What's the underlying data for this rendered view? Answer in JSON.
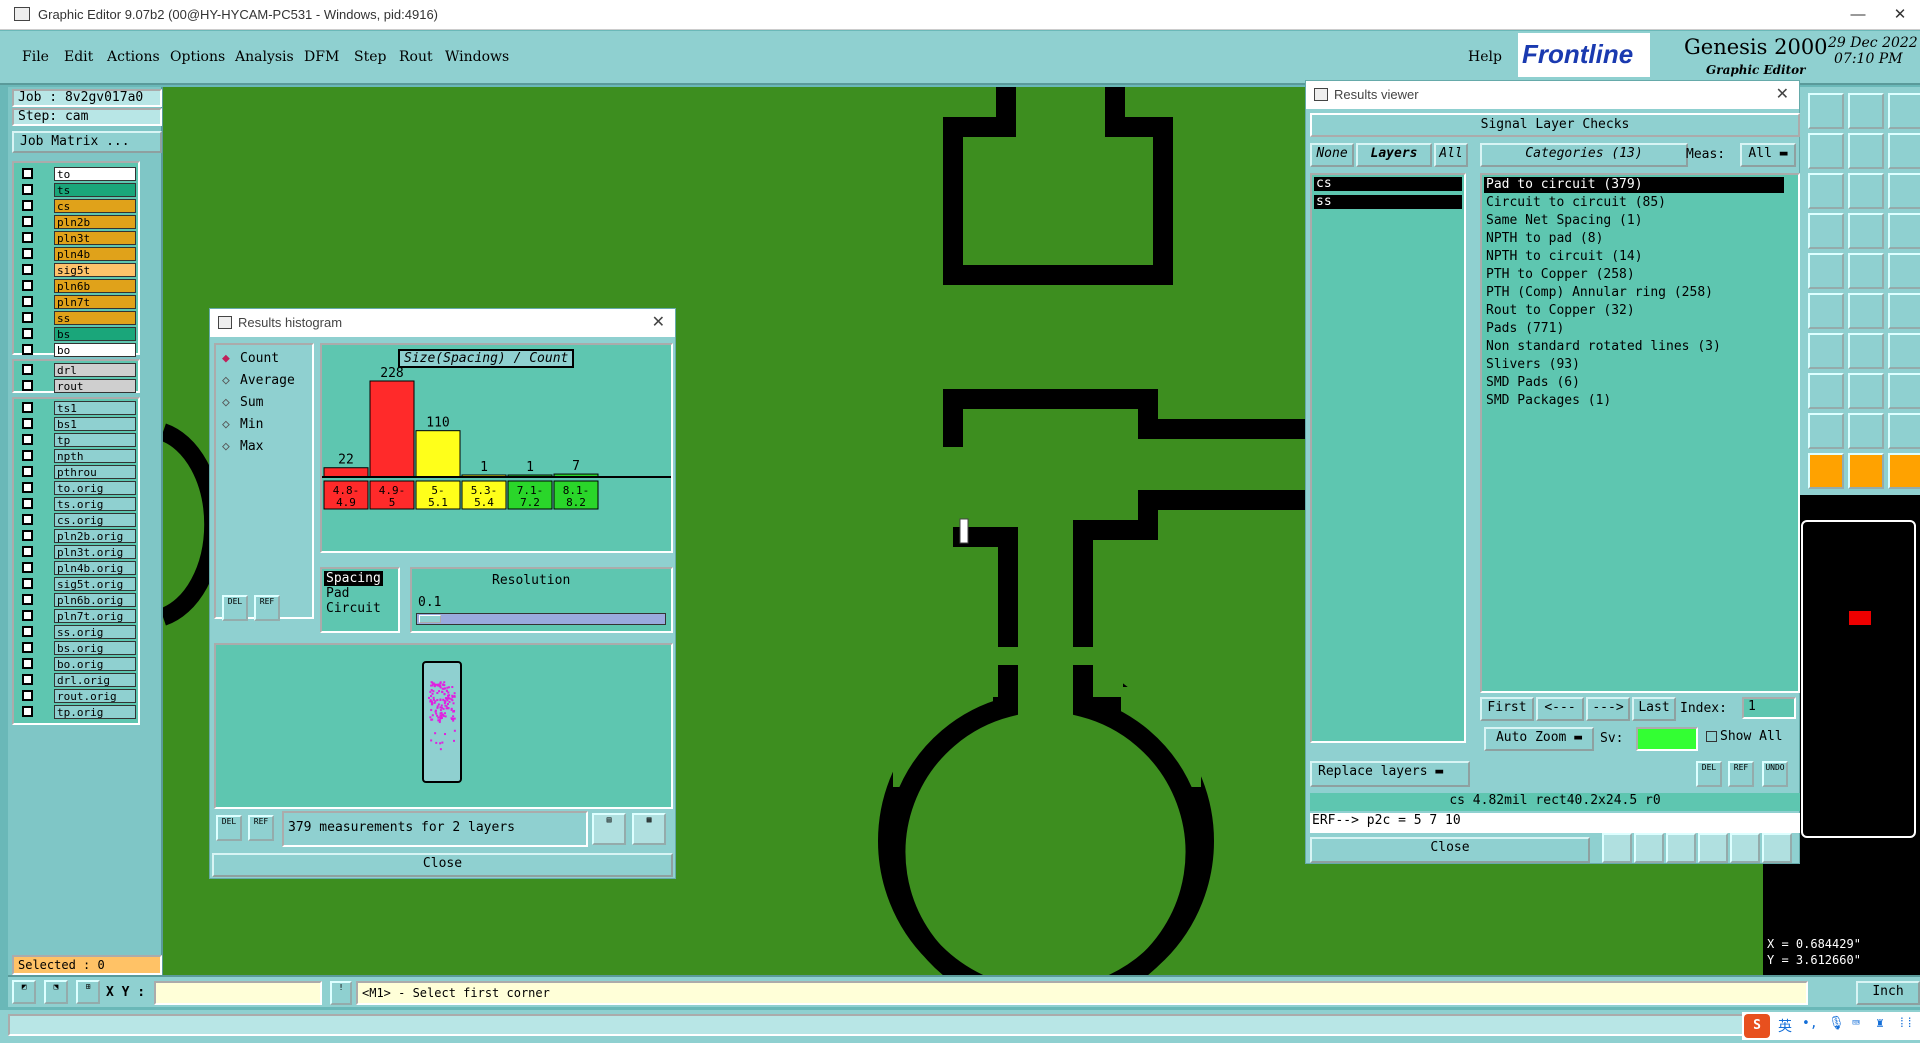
{
  "window": {
    "title": "Graphic Editor 9.07b2 (00@HY-HYCAM-PC531 - Windows, pid:4916)",
    "minimize": "—",
    "maximize": "☐",
    "close": "✕"
  },
  "menu": [
    "File",
    "Edit",
    "Actions",
    "Options",
    "Analysis",
    "DFM",
    "Step",
    "Rout",
    "Windows"
  ],
  "help": "Help",
  "brand": {
    "logo": "Frontline",
    "product": "Genesis 2000",
    "subtitle": "Graphic Editor",
    "date": "29 Dec 2022",
    "time": "07:10 PM"
  },
  "left": {
    "job": "Job : 8v2gv017a0",
    "step": "Step: cam",
    "job_matrix": "Job Matrix ...",
    "layers_a": [
      {
        "name": "to",
        "color": "#ffffff"
      },
      {
        "name": "ts",
        "color": "#1aa67a"
      },
      {
        "name": "cs",
        "color": "#e0a21a",
        "mark": "↗"
      },
      {
        "name": "pln2b",
        "color": "#e0a21a"
      },
      {
        "name": "pln3t",
        "color": "#e0a21a"
      },
      {
        "name": "pln4b",
        "color": "#e0a21a"
      },
      {
        "name": "sig5t",
        "color": "#ffc36a"
      },
      {
        "name": "pln6b",
        "color": "#e0a21a"
      },
      {
        "name": "pln7t",
        "color": "#e0a21a"
      },
      {
        "name": "ss",
        "color": "#e0a21a",
        "mark": "↗"
      },
      {
        "name": "bs",
        "color": "#1aa67a"
      },
      {
        "name": "bo",
        "color": "#ffffff"
      }
    ],
    "layers_b": [
      {
        "name": "drl",
        "color": "#cfcfcf"
      },
      {
        "name": "rout",
        "color": "#cfcfcf"
      }
    ],
    "layers_c": [
      {
        "name": "ts1"
      },
      {
        "name": "bs1"
      },
      {
        "name": "tp"
      },
      {
        "name": "npth"
      },
      {
        "name": "pthrou"
      },
      {
        "name": "to.orig"
      },
      {
        "name": "ts.orig"
      },
      {
        "name": "cs.orig",
        "mark": "↗"
      },
      {
        "name": "pln2b.orig"
      },
      {
        "name": "pln3t.orig"
      },
      {
        "name": "pln4b.orig"
      },
      {
        "name": "sig5t.orig"
      },
      {
        "name": "pln6b.orig"
      },
      {
        "name": "pln7t.orig"
      },
      {
        "name": "ss.orig",
        "mark": "↗"
      },
      {
        "name": "bs.orig"
      },
      {
        "name": "bo.orig"
      },
      {
        "name": "drl.orig"
      },
      {
        "name": "rout.orig"
      },
      {
        "name": "tp.orig"
      }
    ],
    "selected": "Selected : 0"
  },
  "histogram": {
    "title": "Results histogram",
    "modes": [
      "Count",
      "Average",
      "Sum",
      "Min",
      "Max"
    ],
    "selected_mode": "Count",
    "chart_title": "Size(Spacing) / Count",
    "bars": [
      {
        "value": 22,
        "label": "22",
        "range": "4.8-\n4.9",
        "color": "#ff2a2a"
      },
      {
        "value": 228,
        "label": "228",
        "range": "4.9-\n5",
        "color": "#ff2a2a"
      },
      {
        "value": 110,
        "label": "110",
        "range": "5-\n5.1",
        "color": "#ffff1a"
      },
      {
        "value": 1,
        "label": "1",
        "range": "5.3-\n5.4",
        "color": "#ffff1a"
      },
      {
        "value": 1,
        "label": "1",
        "range": "7.1-\n7.2",
        "color": "#2ad62a"
      },
      {
        "value": 7,
        "label": "7",
        "range": "8.1-\n8.2",
        "color": "#2ad62a"
      }
    ],
    "list": [
      "Spacing",
      "Pad",
      "Circuit"
    ],
    "resolution_label": "Resolution",
    "resolution": "0.1",
    "del": "DEL",
    "ref": "REF",
    "measure_text": "379 measurements for 2 layers",
    "close": "Close"
  },
  "results": {
    "title": "Results viewer",
    "heading": "Signal Layer Checks",
    "none": "None",
    "layers_label": "Layers",
    "all": "All",
    "layers": [
      "cs",
      "ss"
    ],
    "categories_label": "Categories (13)",
    "meas_label": "Meas:",
    "meas_value": "All",
    "categories": [
      "Pad to circuit (379)",
      "Circuit to circuit (85)",
      "Same Net Spacing (1)",
      "NPTH to pad (8)",
      "NPTH to circuit (14)",
      "PTH to Copper (258)",
      "PTH (Comp) Annular ring (258)",
      "Rout to Copper (32)",
      "Pads (771)",
      "Non standard rotated lines (3)",
      "Slivers (93)",
      "SMD Pads (6)",
      "SMD Packages (1)"
    ],
    "first": "First",
    "prev": "<---",
    "next": "--->",
    "last": "Last",
    "index_label": "Index:",
    "index_value": "1",
    "auto_zoom": "Auto Zoom",
    "sv_label": "Sv:",
    "show_all": "Show All",
    "replace_layers": "Replace layers",
    "info1": "cs 4.82mil  rect40.2x24.5  r0",
    "info2": "ERF--> p2c = 5 7 10",
    "close": "Close",
    "del": "DEL",
    "ref": "REF",
    "undo": "UNDO"
  },
  "coords": {
    "x": "X = 0.684429\"",
    "y": "Y = 3.612660\""
  },
  "status": {
    "xy_label": "X Y :",
    "xy_value": "",
    "prompt": "<M1> - Select first corner",
    "units": "Inch"
  },
  "taskbar": {
    "ime": "英"
  },
  "colors": {
    "board": "#3d8e1f",
    "panel": "#8fd0d0",
    "accent": "#ffa200"
  }
}
